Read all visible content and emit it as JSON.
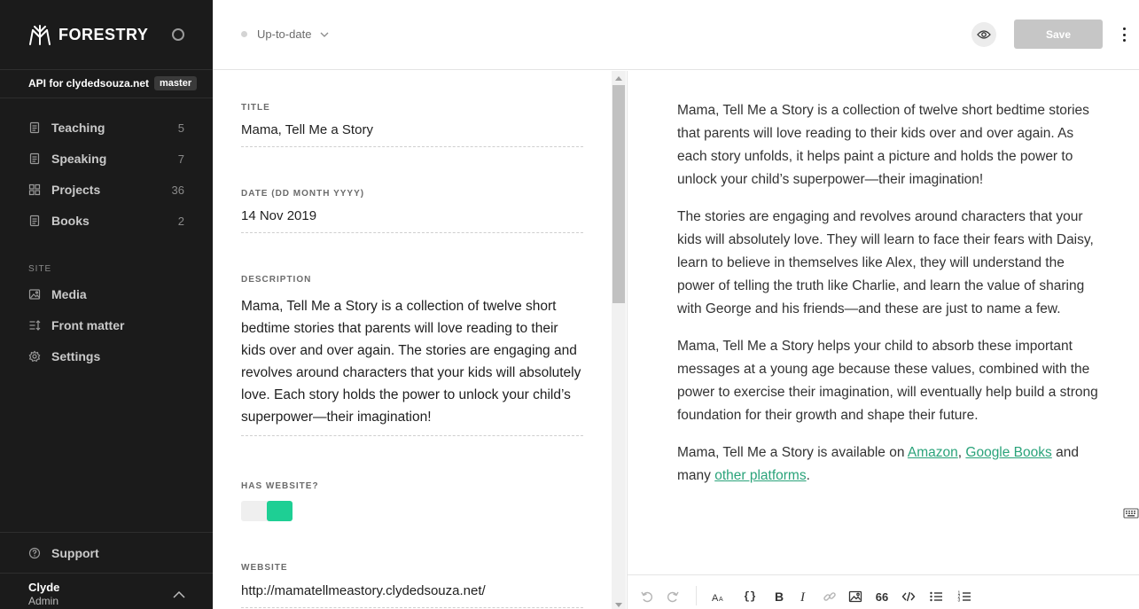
{
  "app": {
    "brand": "FORESTRY"
  },
  "site": {
    "name": "API for clydedsouza.net",
    "branch": "master"
  },
  "nav": {
    "content": [
      {
        "label": "Teaching",
        "count": "5",
        "icon": "document-icon"
      },
      {
        "label": "Speaking",
        "count": "7",
        "icon": "document-icon"
      },
      {
        "label": "Projects",
        "count": "36",
        "icon": "grid-icon"
      },
      {
        "label": "Books",
        "count": "2",
        "icon": "document-icon"
      }
    ],
    "site_label": "SITE",
    "site": [
      {
        "label": "Media",
        "icon": "image-icon"
      },
      {
        "label": "Front matter",
        "icon": "front-matter-icon"
      },
      {
        "label": "Settings",
        "icon": "gear-icon"
      }
    ],
    "support": "Support"
  },
  "user": {
    "name": "Clyde",
    "role": "Admin"
  },
  "topbar": {
    "status": "Up-to-date",
    "save_label": "Save"
  },
  "form": {
    "title_label": "TITLE",
    "title_value": "Mama, Tell Me a Story",
    "date_label": "DATE (DD MONTH YYYY)",
    "date_value": "14 Nov 2019",
    "description_label": "DESCRIPTION",
    "description_value": "Mama, Tell Me a Story is a collection of twelve short bedtime stories that parents will love reading to their kids over and over again. The stories are engaging and revolves around characters that your kids will absolutely love. Each story holds the power to unlock your child’s superpower—their imagination!",
    "has_website_label": "HAS WEBSITE?",
    "has_website_value": true,
    "website_label": "WEBSITE",
    "website_value": "http://mamatellmeastory.clydedsouza.net/"
  },
  "editor": {
    "p1": "Mama, Tell Me a Story is a collection of twelve short bedtime stories that parents will love reading to their kids over and over again. As each story unfolds, it helps paint a picture and holds the power to unlock your child’s superpower—their imagination!",
    "p2": "The stories are engaging and revolves around characters that your kids will absolutely love. They will learn to face their fears with Daisy, learn to believe in themselves like Alex, they will understand the power of telling the truth like Charlie, and learn the value of sharing with George and his friends—and these are just to name a few.",
    "p3": "Mama, Tell Me a Story helps your child to absorb these important messages at a young age because these values, combined with the power to exercise their imagination, will eventually help build a strong foundation for their growth and shape their future.",
    "p4_prefix": "Mama, Tell Me a Story is available on ",
    "link_amazon": "Amazon",
    "p4_comma": ", ",
    "link_google": "Google Books",
    "p4_mid": " and many ",
    "link_other": "other platforms",
    "p4_suffix": "."
  },
  "toolbar": {
    "code_label": "{}",
    "quote_label": "66"
  },
  "colors": {
    "sidebar_bg": "#1b1b1b",
    "accent": "#1ecf94",
    "link": "#2aa37a",
    "save_disabled": "#c6c6c6"
  }
}
